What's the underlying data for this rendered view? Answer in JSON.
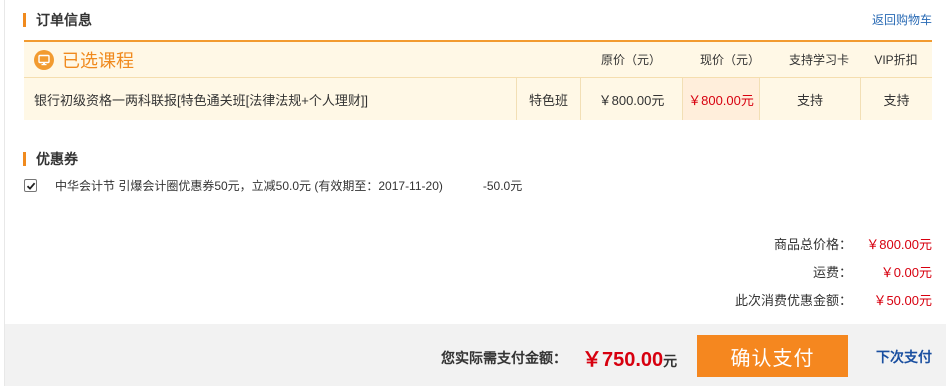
{
  "colors": {
    "accent": "#f08a1e",
    "price_red": "#d7000f",
    "link_blue": "#2a6bb5"
  },
  "order": {
    "title": "订单信息",
    "back_link": "返回购物车"
  },
  "course_table": {
    "title": "已选课程",
    "title_icon": "monitor-icon",
    "headers": {
      "original_price": "原价（元）",
      "current_price": "现价（元）",
      "study_card": "支持学习卡",
      "vip_discount": "VIP折扣"
    },
    "rows": [
      {
        "name": "银行初级资格一两科联报[特色通关班[法律法规+个人理财]]",
        "type": "特色班",
        "original_price": "￥800.00元",
        "current_price": "￥800.00元",
        "study_card": "支持",
        "vip_discount": "支持"
      }
    ]
  },
  "coupon": {
    "title": "优惠券",
    "checked": true,
    "text": "中华会计节 引爆会计圈优惠券50元，立减50.0元 (有效期至：2017-11-20)",
    "amount": "-50.0元"
  },
  "summary": {
    "items": [
      {
        "label": "商品总价格：",
        "value": "￥800.00元"
      },
      {
        "label": "运费：",
        "value": "￥0.00元"
      },
      {
        "label": "此次消费优惠金额：",
        "value": "￥50.00元"
      }
    ]
  },
  "payment": {
    "label": "您实际需支付金额：",
    "currency": "￥",
    "amount": "750.00",
    "unit": "元",
    "confirm_label": "确认支付",
    "later_label": "下次支付"
  }
}
